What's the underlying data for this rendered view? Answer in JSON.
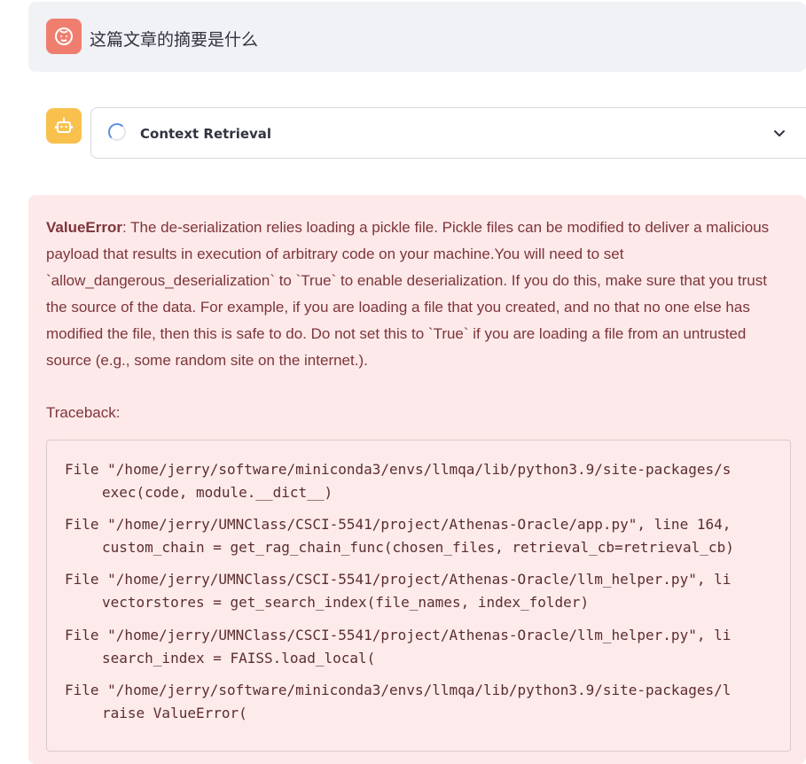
{
  "user_message": {
    "text": "这篇文章的摘要是什么"
  },
  "status": {
    "label": "Context Retrieval"
  },
  "error": {
    "type": "ValueError",
    "message": ": The de-serialization relies loading a pickle file. Pickle files can be modified to deliver a malicious payload that results in execution of arbitrary code on your machine.You will need to set `allow_dangerous_deserialization` to `True` to enable deserialization. If you do this, make sure that you trust the source of the data. For example, if you are loading a file that you created, and no that no one else has modified the file, then this is safe to do. Do not set this to `True` if you are loading a file from an untrusted source (e.g., some random site on the internet.).",
    "traceback_label": "Traceback:",
    "traceback": [
      {
        "file": "File \"/home/jerry/software/miniconda3/envs/llmqa/lib/python3.9/site-packages/s",
        "code": "exec(code, module.__dict__)"
      },
      {
        "file": "File \"/home/jerry/UMNClass/CSCI-5541/project/Athenas-Oracle/app.py\", line 164,",
        "code": "custom_chain = get_rag_chain_func(chosen_files, retrieval_cb=retrieval_cb)"
      },
      {
        "file": "File \"/home/jerry/UMNClass/CSCI-5541/project/Athenas-Oracle/llm_helper.py\", li",
        "code": "vectorstores = get_search_index(file_names, index_folder)"
      },
      {
        "file": "File \"/home/jerry/UMNClass/CSCI-5541/project/Athenas-Oracle/llm_helper.py\", li",
        "code": "search_index = FAISS.load_local("
      },
      {
        "file": "File \"/home/jerry/software/miniconda3/envs/llmqa/lib/python3.9/site-packages/l",
        "code": "raise ValueError("
      }
    ]
  },
  "colors": {
    "user_avatar": "#f07e6e",
    "bot_avatar": "#f8c14e",
    "error_bg": "#fde9e9",
    "error_text": "#7d353b"
  }
}
